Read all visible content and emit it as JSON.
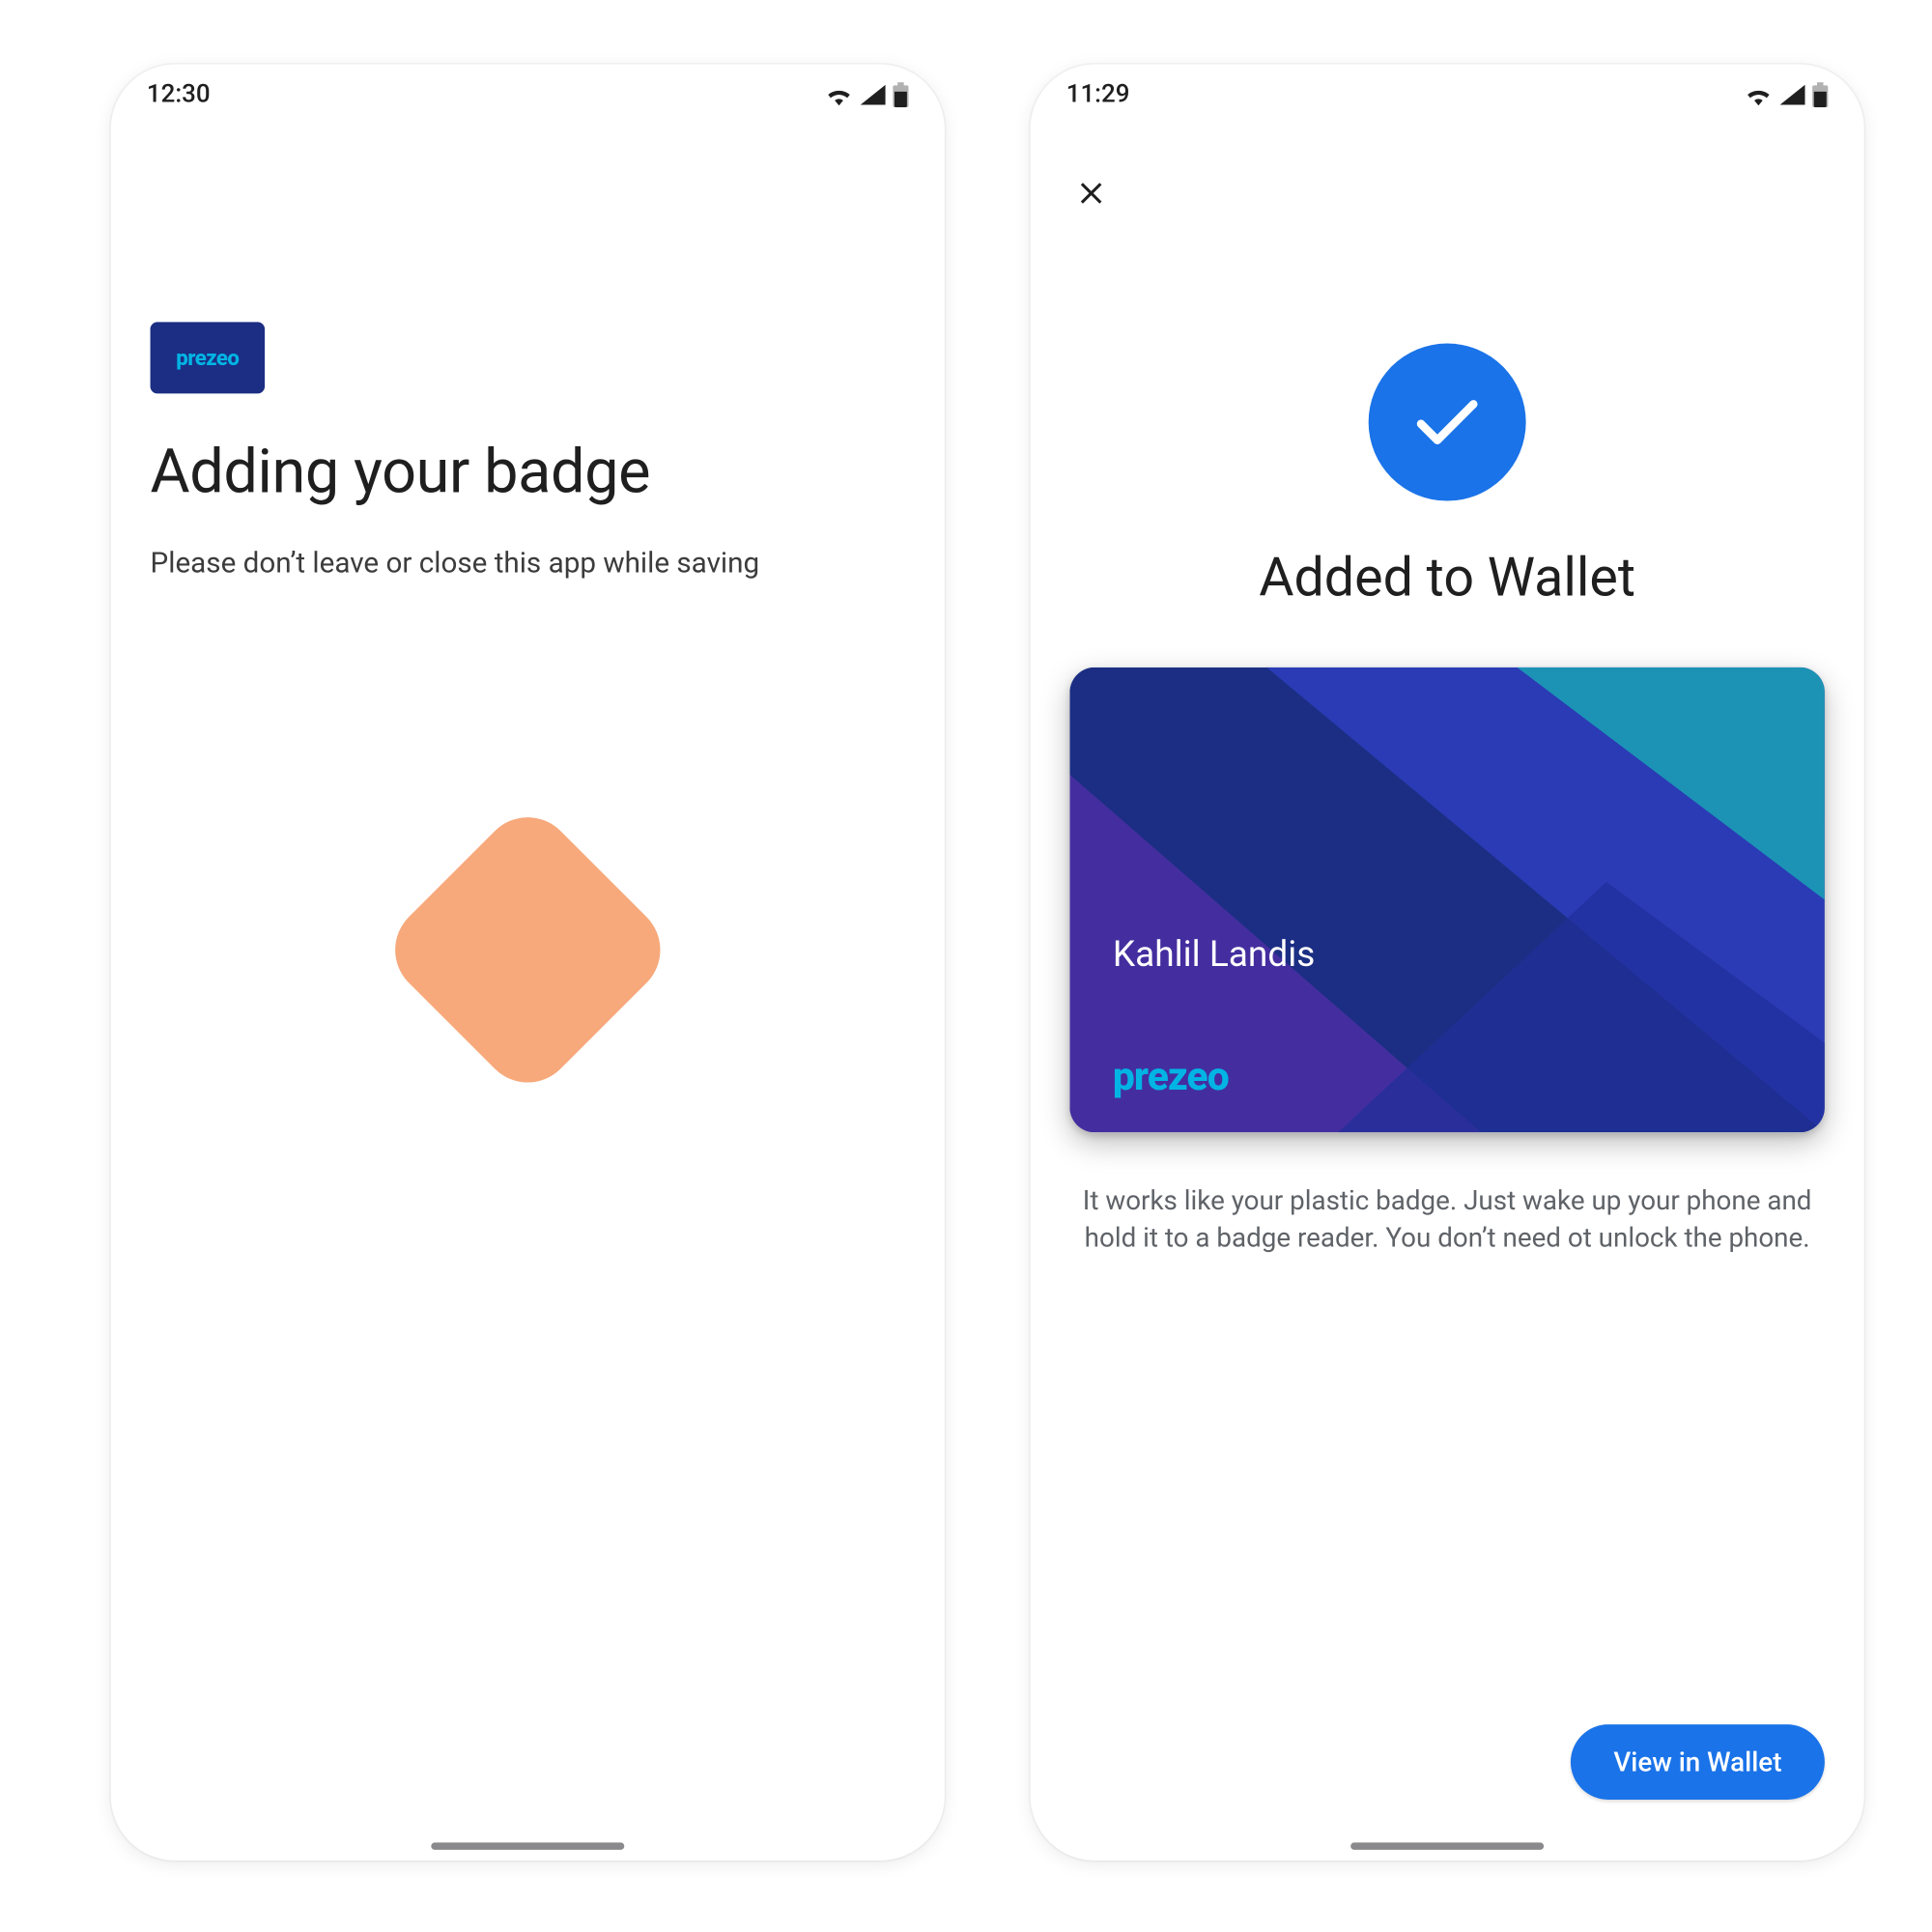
{
  "left": {
    "status_time": "12:30",
    "logo_label": "prezeo",
    "title": "Adding your badge",
    "subtitle": "Please don’t leave or close this app while saving",
    "spinner_color": "#f7a97b"
  },
  "right": {
    "status_time": "11:29",
    "close_icon": "close-icon",
    "check_circle_color": "#1a73e8",
    "title": "Added to Wallet",
    "card": {
      "holder_name": "Kahlil Landis",
      "brand_label": "prezeo",
      "card_colors": {
        "base": "#1b2e83",
        "violet": "#4b2ea5",
        "indigo": "#2a3bb5",
        "cyan": "#1aa3b5"
      }
    },
    "description": "It works like your plastic badge. Just wake up your phone and hold it to a badge reader. You don’t need ot unlock the phone.",
    "cta_label": "View in Wallet"
  },
  "status_icons": [
    "wifi-icon",
    "cellular-icon",
    "battery-icon"
  ]
}
